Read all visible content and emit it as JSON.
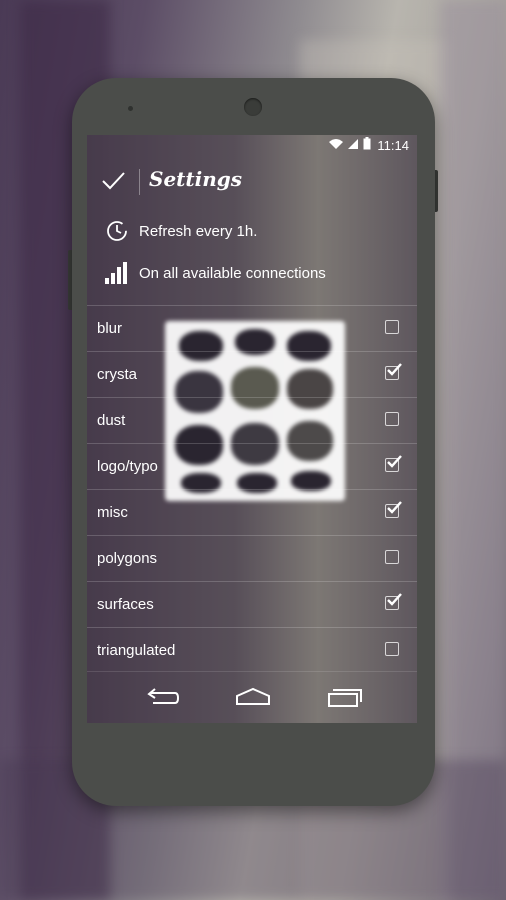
{
  "status_bar": {
    "time": "11:14",
    "icons": [
      "wifi-icon",
      "signal-icon",
      "battery-icon"
    ]
  },
  "action_bar": {
    "title": "Settings",
    "confirm_icon": "check-icon"
  },
  "settings": {
    "refresh": {
      "label": "Refresh every 1h.",
      "icon": "clock-icon"
    },
    "connection": {
      "label": "On all available connections",
      "icon": "signal-bars-icon"
    }
  },
  "categories": [
    {
      "label": "blur",
      "checked": false
    },
    {
      "label": "crysta",
      "checked": true
    },
    {
      "label": "dust",
      "checked": false
    },
    {
      "label": "logo/typo",
      "checked": true
    },
    {
      "label": "misc",
      "checked": true
    },
    {
      "label": "polygons",
      "checked": false
    },
    {
      "label": "surfaces",
      "checked": true
    },
    {
      "label": "triangulated",
      "checked": false
    }
  ],
  "nav_bar": {
    "buttons": [
      "back-icon",
      "home-icon",
      "recents-icon"
    ]
  },
  "colors": {
    "device_body": "#4b4d4a",
    "text": "#ffffff"
  }
}
